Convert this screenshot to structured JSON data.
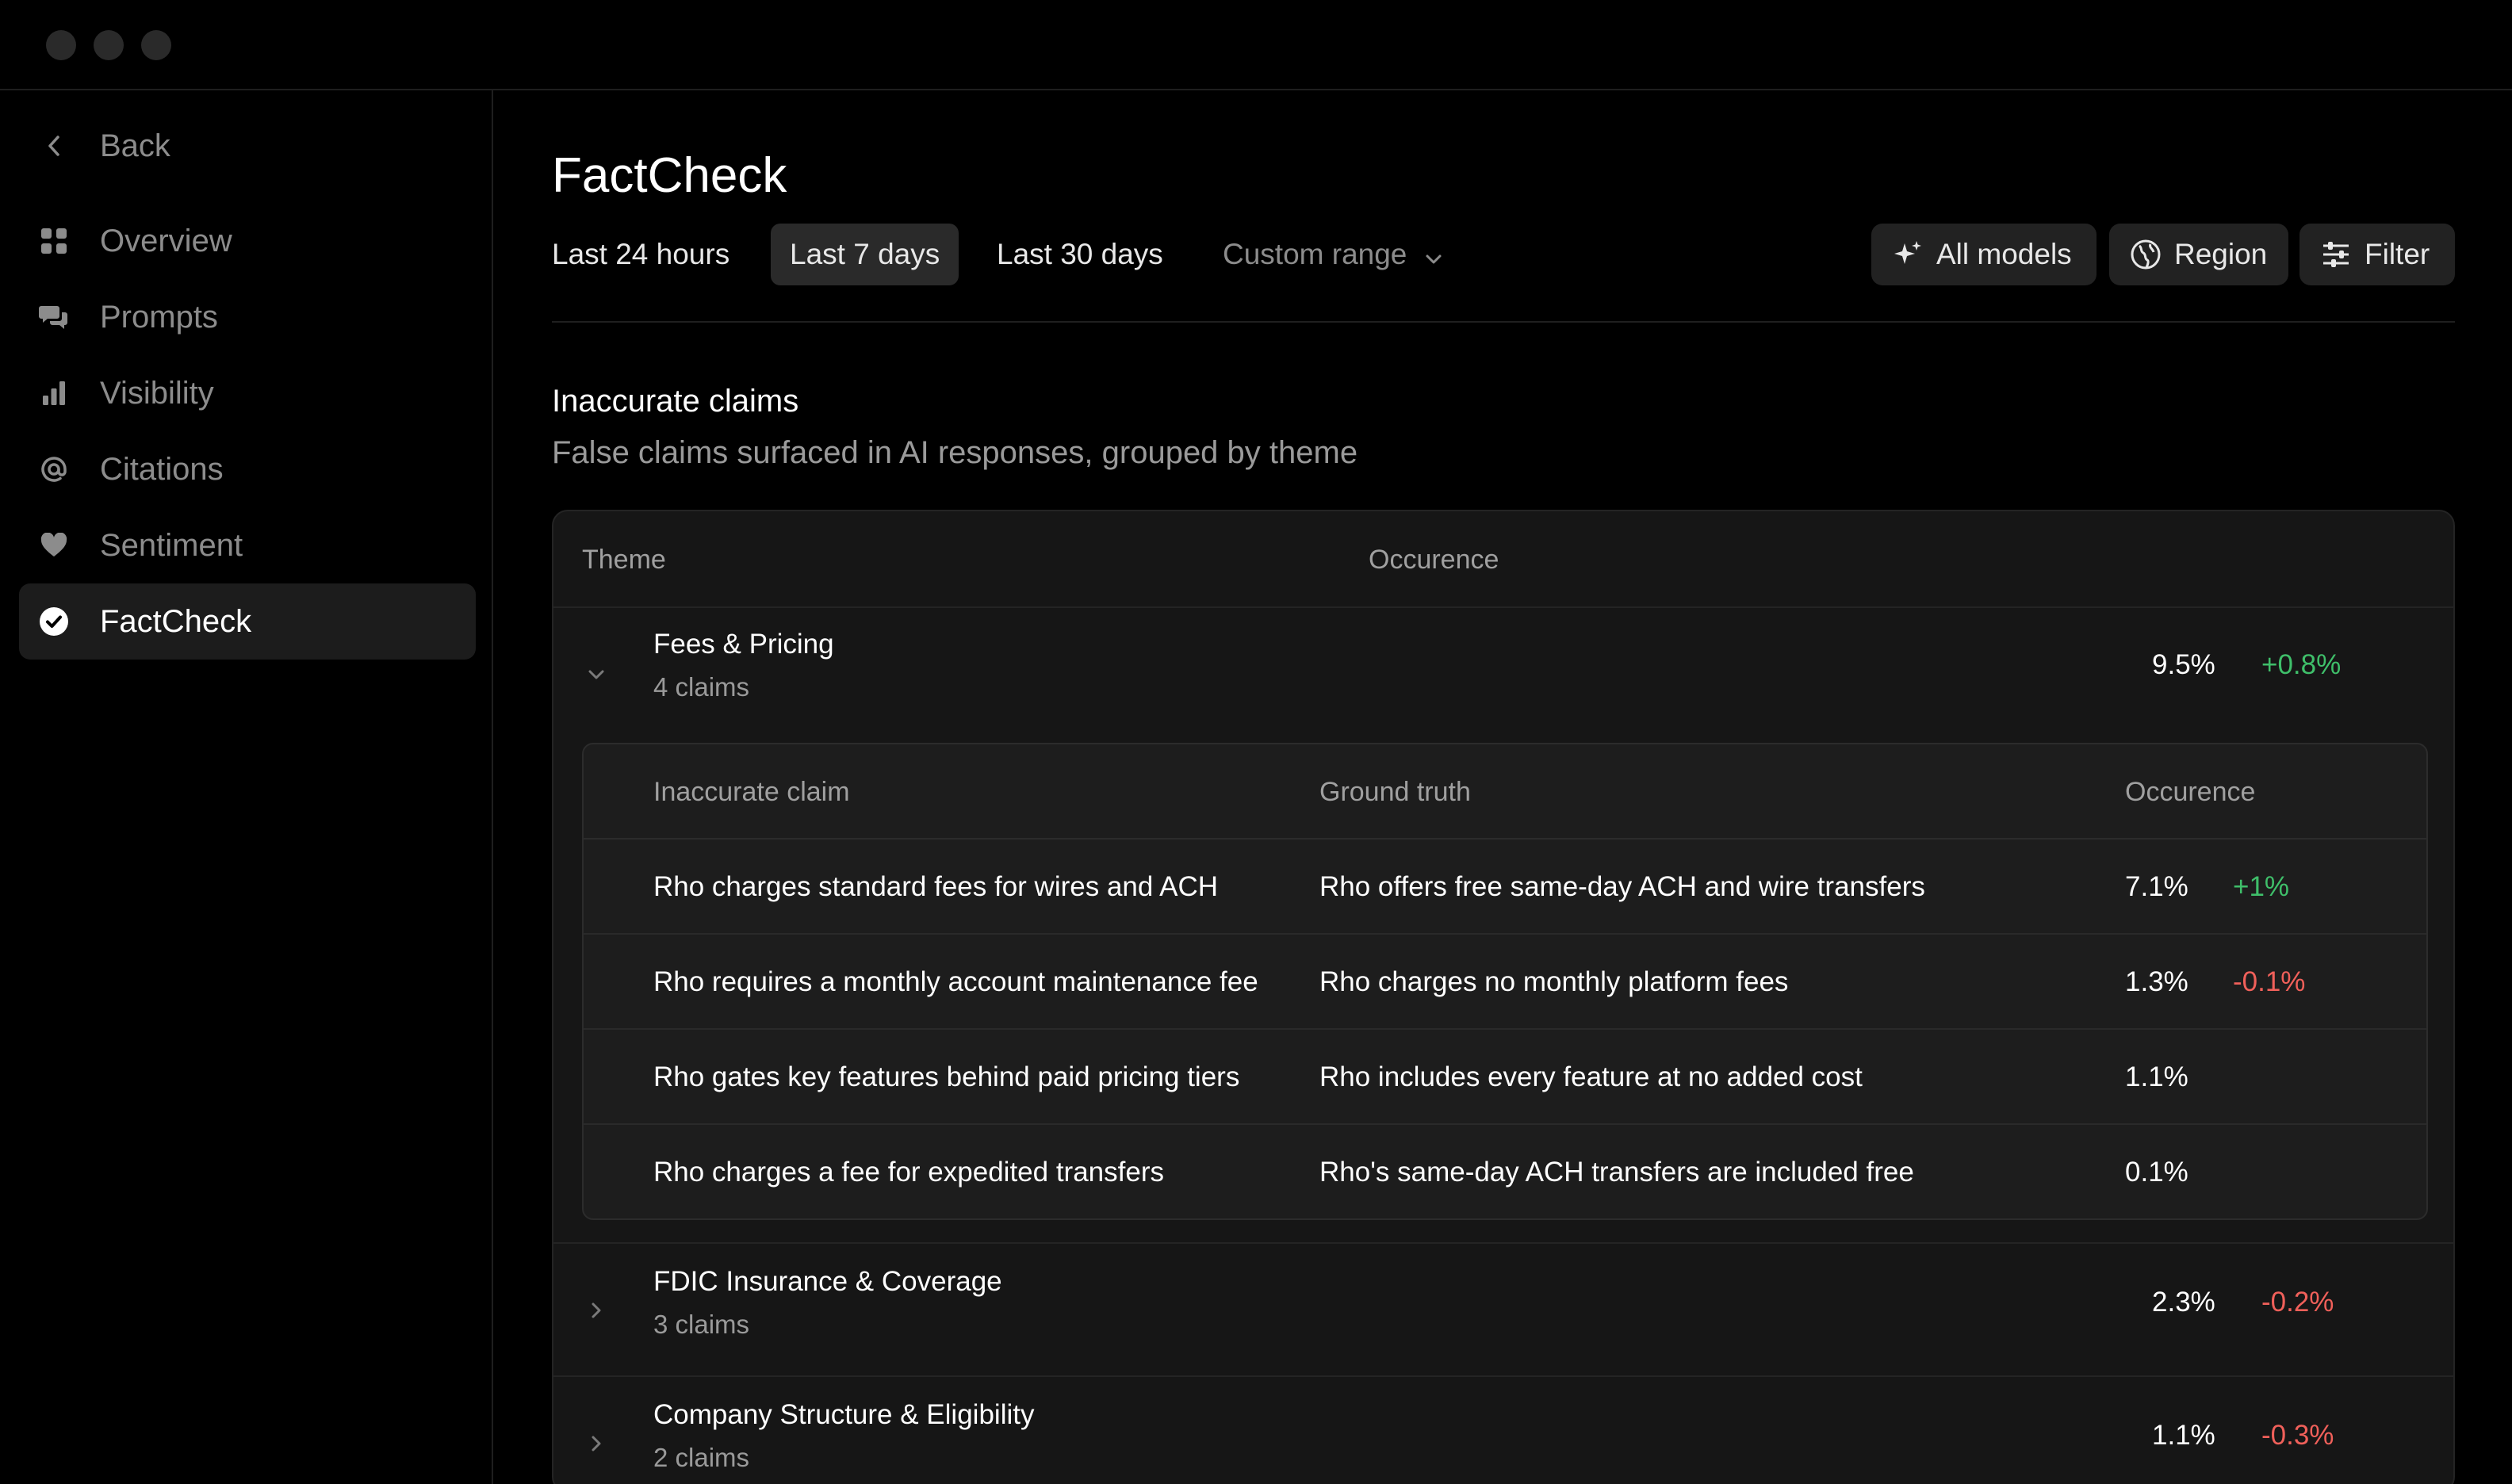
{
  "sidebar": {
    "back_label": "Back",
    "items": [
      {
        "label": "Overview",
        "icon": "grid-icon"
      },
      {
        "label": "Prompts",
        "icon": "chat-bubbles-icon"
      },
      {
        "label": "Visibility",
        "icon": "bar-chart-icon"
      },
      {
        "label": "Citations",
        "icon": "at-sign-icon"
      },
      {
        "label": "Sentiment",
        "icon": "heart-icon"
      },
      {
        "label": "FactCheck",
        "icon": "check-circle-icon",
        "active": true
      }
    ]
  },
  "page": {
    "title": "FactCheck",
    "ranges": [
      "Last 24 hours",
      "Last 7 days",
      "Last 30 days"
    ],
    "selected_range": "Last 7 days",
    "custom_range_label": "Custom range",
    "tools": {
      "models": "All models",
      "region": "Region",
      "filter": "Filter"
    }
  },
  "section": {
    "title": "Inaccurate claims",
    "subtitle": "False claims surfaced in AI responses, grouped by theme"
  },
  "table": {
    "col_theme": "Theme",
    "col_occurrence": "Occurence",
    "groups": [
      {
        "name": "Fees & Pricing",
        "count": "4 claims",
        "pct": "9.5%",
        "delta": "+0.8%",
        "expanded": true,
        "sub_headers": {
          "claim": "Inaccurate claim",
          "truth": "Ground truth",
          "occurrence": "Occurence"
        },
        "claims": [
          {
            "claim": "Rho charges standard fees for wires and ACH",
            "truth": "Rho offers free same-day ACH and wire transfers",
            "pct": "7.1%",
            "delta": "+1%"
          },
          {
            "claim": "Rho requires a monthly account maintenance fee",
            "truth": "Rho charges no monthly platform fees",
            "pct": "1.3%",
            "delta": "-0.1%"
          },
          {
            "claim": "Rho gates key features behind paid pricing tiers",
            "truth": "Rho includes every feature at no added cost",
            "pct": "1.1%",
            "delta": ""
          },
          {
            "claim": "Rho charges a fee for expedited transfers",
            "truth": "Rho's same-day ACH transfers are included free",
            "pct": "0.1%",
            "delta": ""
          }
        ]
      },
      {
        "name": "FDIC Insurance & Coverage",
        "count": "3 claims",
        "pct": "2.3%",
        "delta": "-0.2%"
      },
      {
        "name": "Company Structure & Eligibility",
        "count": "2 claims",
        "pct": "1.1%",
        "delta": "-0.3%"
      }
    ]
  },
  "colors": {
    "positive": "#3fbf6a",
    "negative": "#f0605a",
    "background": "#000000",
    "panel": "#161616"
  }
}
